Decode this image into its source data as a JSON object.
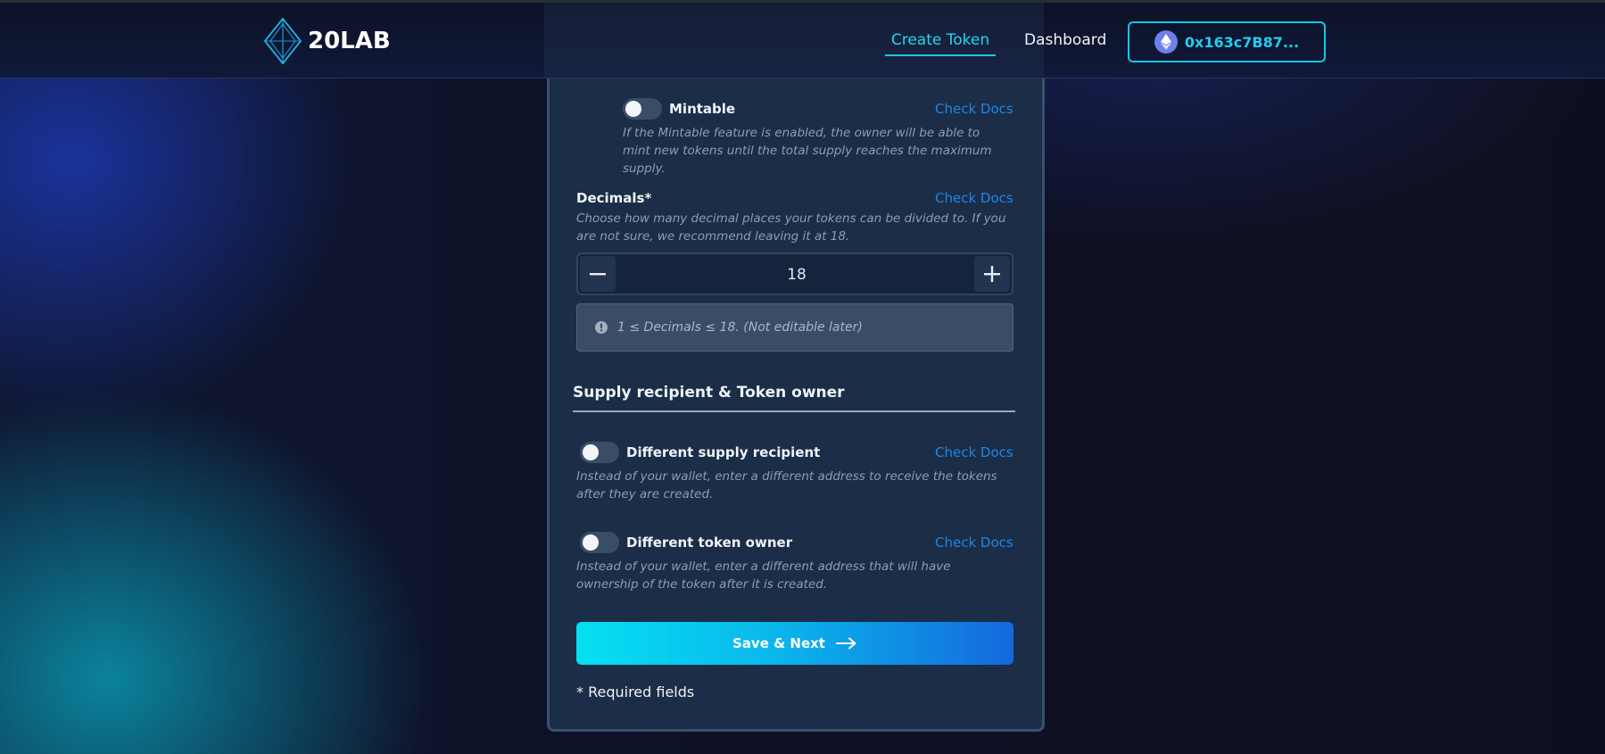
{
  "header": {
    "brand": "20LAB",
    "nav": {
      "create_token": "Create Token",
      "dashboard": "Dashboard"
    },
    "wallet": {
      "address": "0x163c7B87...",
      "icon": "ethereum-icon"
    }
  },
  "mintable": {
    "label": "Mintable",
    "docs": "Check Docs",
    "description": "If the Mintable feature is enabled, the owner will be able to mint new tokens until the total supply reaches the maximum supply.",
    "enabled": false
  },
  "decimals": {
    "label": "Decimals*",
    "docs": "Check Docs",
    "description": "Choose how many decimal places your tokens can be divided to. If you are not sure, we recommend leaving it at 18.",
    "value": "18",
    "hint": "1 ≤ Decimals ≤ 18. (Not editable later)"
  },
  "supply_section": {
    "title": "Supply recipient & Token owner",
    "recipient": {
      "label": "Different supply recipient",
      "docs": "Check Docs",
      "description": "Instead of your wallet, enter a different address to receive the tokens after they are created.",
      "enabled": false
    },
    "owner": {
      "label": "Different token owner",
      "docs": "Check Docs",
      "description": "Instead of your wallet, enter a different address that will have ownership of the token after it is created.",
      "enabled": false
    }
  },
  "actions": {
    "save_next": "Save & Next"
  },
  "footer_note": "* Required fields",
  "colors": {
    "accent": "#22d6f0",
    "docs_link": "#1f86e4",
    "panel": "#1c2d47"
  }
}
